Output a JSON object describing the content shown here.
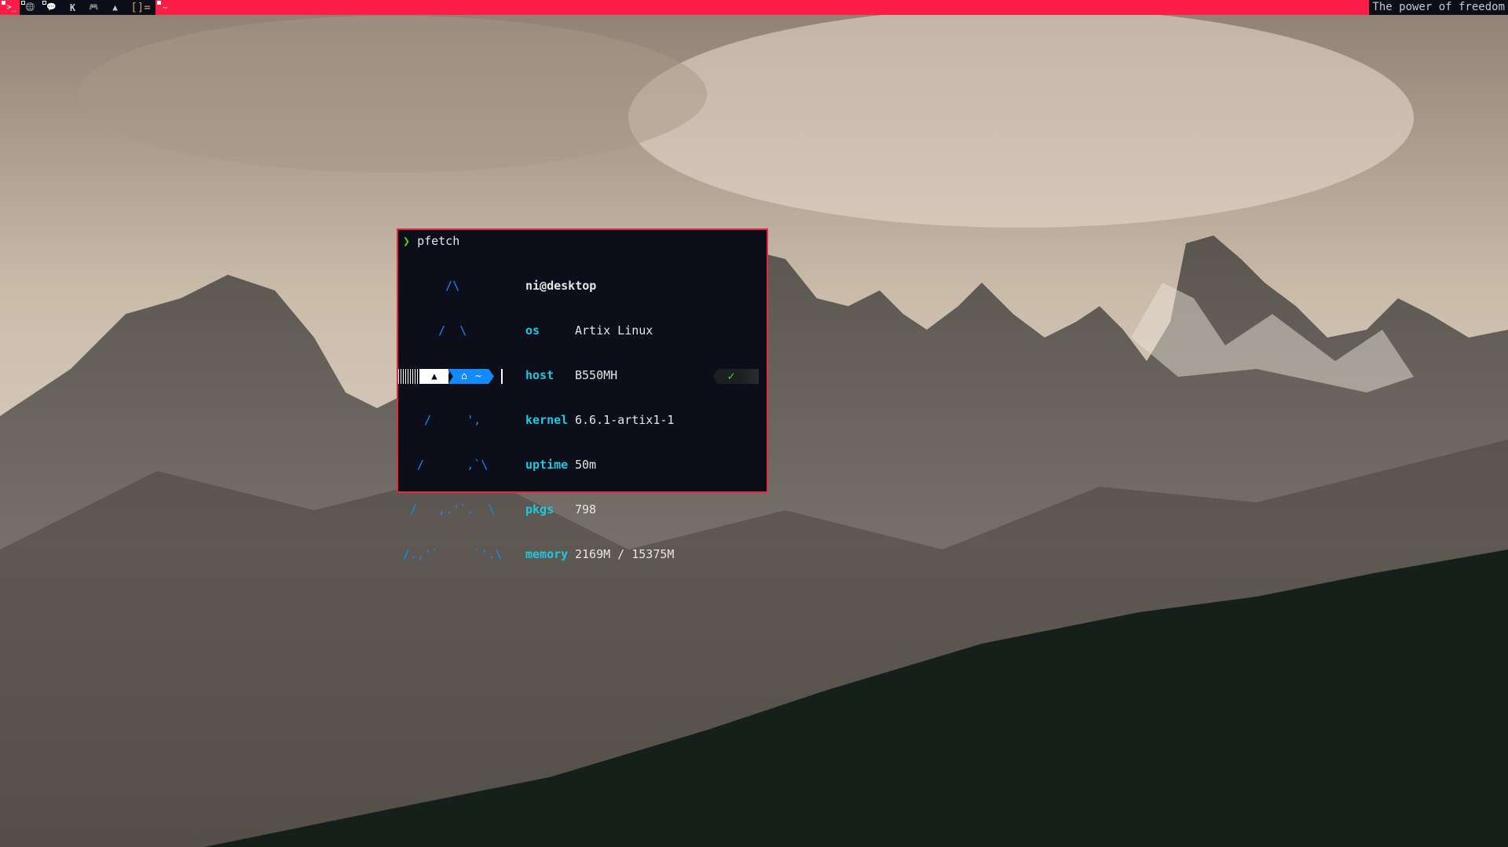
{
  "colors": {
    "bar": "#fd1d48",
    "terminal_bg": "#0c0f1a",
    "accent_blue": "#138aff",
    "label_cyan": "#1ec8e0",
    "prompt_green": "#4ed60c"
  },
  "bar": {
    "workspaces": [
      {
        "icon": "terminal-icon",
        "glyph": ">_",
        "active": true
      },
      {
        "icon": "globe-icon",
        "glyph": "🌐",
        "active": false
      },
      {
        "icon": "chat-icon",
        "glyph": "💬",
        "active": false
      },
      {
        "icon": "editor-icon",
        "glyph": "K",
        "active": false
      },
      {
        "icon": "gamepad-icon",
        "glyph": "🎮",
        "active": false
      },
      {
        "icon": "artix-icon",
        "glyph": "▲",
        "active": false
      }
    ],
    "layout": "[]=",
    "window_glyph": "~",
    "title": "The power of freedom"
  },
  "terminal": {
    "prompt_symbol": "❯",
    "command": "pfetch",
    "art": [
      "      /\\",
      "     /  \\",
      "    /`'.,\\",
      "   /     ',",
      "  /      ,`\\",
      " /   ,.'`.  \\",
      "/.,'`     `'.\\"
    ],
    "user_host": "ni@desktop",
    "info": [
      {
        "label": "os",
        "value": "Artix Linux"
      },
      {
        "label": "host",
        "value": "B550MH"
      },
      {
        "label": "kernel",
        "value": "6.6.1-artix1-1"
      },
      {
        "label": "uptime",
        "value": "50m"
      },
      {
        "label": "pkgs",
        "value": "798"
      },
      {
        "label": "memory",
        "value": "2169M / 15375M"
      }
    ],
    "prompt_dir": "~",
    "status": "✓"
  }
}
